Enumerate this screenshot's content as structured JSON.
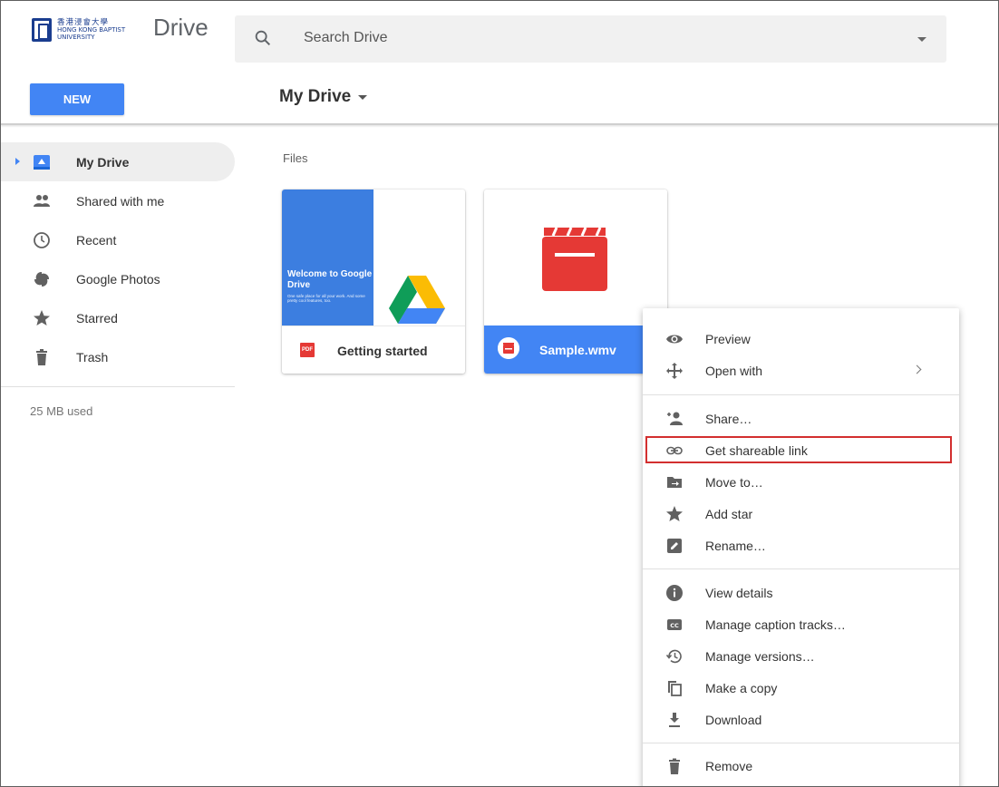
{
  "header": {
    "logo_cn": "香港浸會大學",
    "logo_en": "HONG KONG BAPTIST UNIVERSITY",
    "app_name": "Drive",
    "search_placeholder": "Search Drive"
  },
  "toolbar": {
    "new_label": "NEW",
    "location_title": "My Drive"
  },
  "sidebar": {
    "items": [
      {
        "label": "My Drive",
        "icon": "my-drive-icon",
        "active": true
      },
      {
        "label": "Shared with me",
        "icon": "people-icon",
        "active": false
      },
      {
        "label": "Recent",
        "icon": "clock-icon",
        "active": false
      },
      {
        "label": "Google Photos",
        "icon": "pinwheel-icon",
        "active": false
      },
      {
        "label": "Starred",
        "icon": "star-icon",
        "active": false
      },
      {
        "label": "Trash",
        "icon": "trash-icon",
        "active": false
      }
    ],
    "usage": "25 MB used"
  },
  "main": {
    "section_label": "Files",
    "files": [
      {
        "name": "Getting started",
        "type_badge": "PDF",
        "thumb_title": "Welcome to Google Drive",
        "thumb_text": "One safe place for all your work. And some pretty cool features, too.",
        "selected": false
      },
      {
        "name": "Sample.wmv",
        "selected": true
      }
    ]
  },
  "context_menu": {
    "items": [
      {
        "label": "Preview",
        "icon": "eye-icon"
      },
      {
        "label": "Open with",
        "icon": "move-arrows-icon",
        "submenu": true
      },
      {
        "label": "Share…",
        "icon": "add-person-icon"
      },
      {
        "label": "Get shareable link",
        "icon": "link-icon",
        "highlighted": true
      },
      {
        "label": "Move to…",
        "icon": "folder-move-icon"
      },
      {
        "label": "Add star",
        "icon": "star-icon"
      },
      {
        "label": "Rename…",
        "icon": "edit-icon"
      },
      {
        "label": "View details",
        "icon": "info-icon"
      },
      {
        "label": "Manage caption tracks…",
        "icon": "cc-icon"
      },
      {
        "label": "Manage versions…",
        "icon": "history-icon"
      },
      {
        "label": "Make a copy",
        "icon": "copy-icon"
      },
      {
        "label": "Download",
        "icon": "download-icon"
      },
      {
        "label": "Remove",
        "icon": "trash-icon"
      }
    ]
  },
  "colors": {
    "accent": "#4285f4",
    "highlight_border": "#d32f2f",
    "video_red": "#e53935"
  }
}
